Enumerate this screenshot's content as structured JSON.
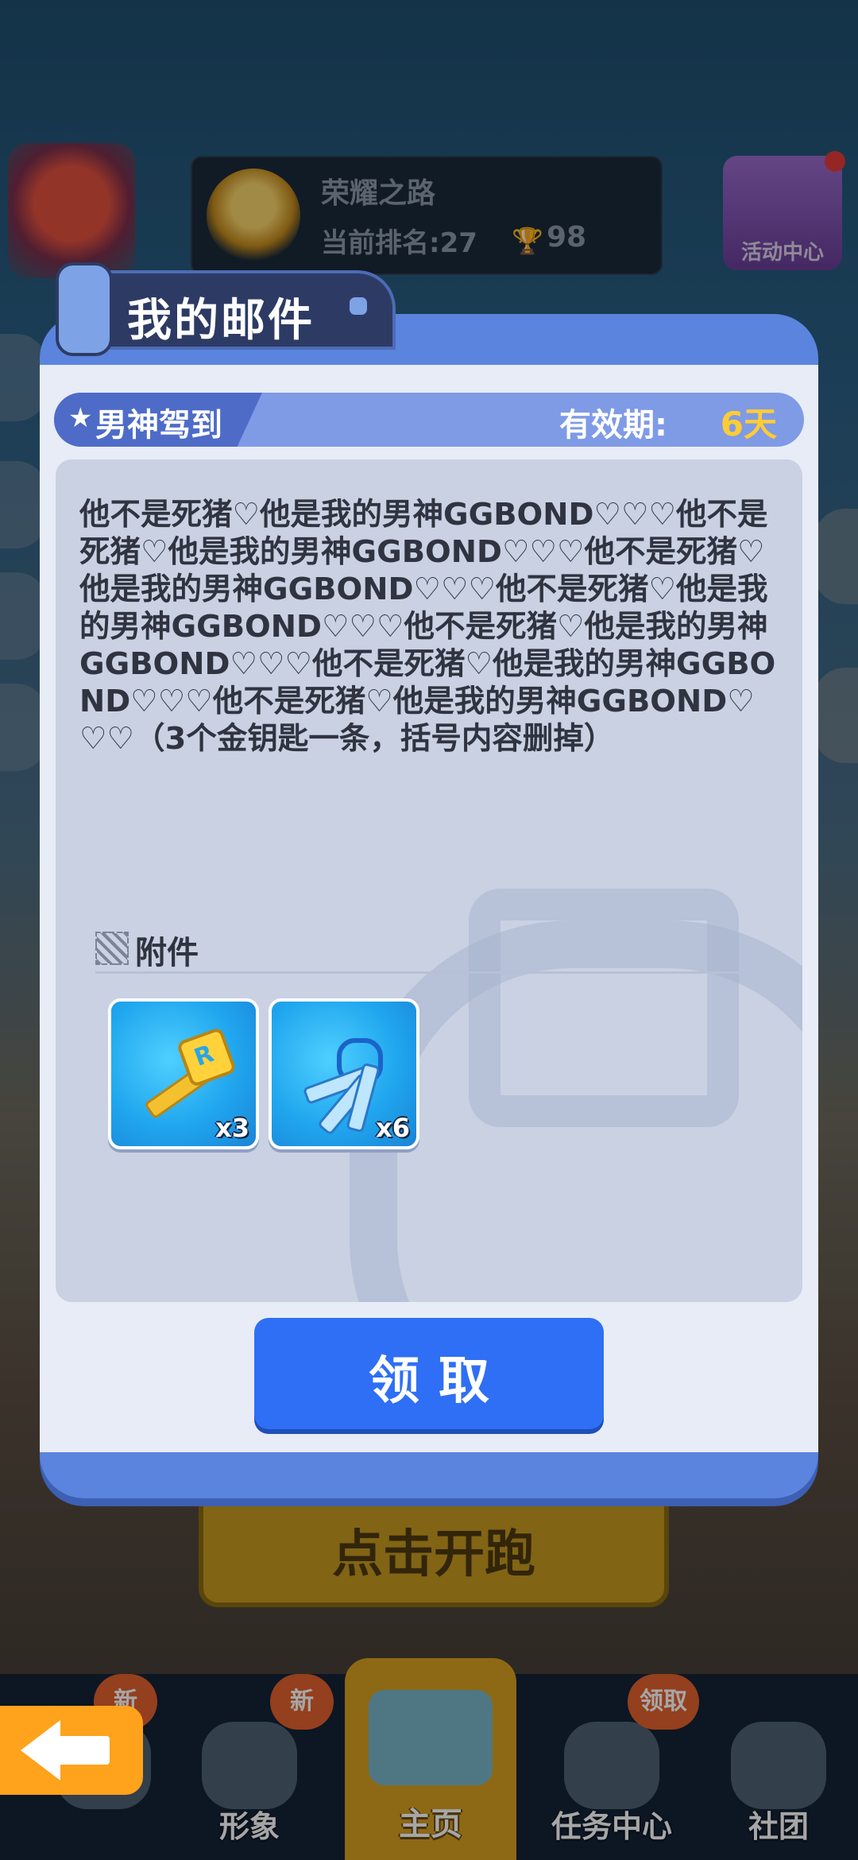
{
  "background": {
    "glory_panel": {
      "title": "荣耀之路",
      "rank_label": "当前排名:27",
      "trophy_count": "98"
    },
    "activity_center": {
      "label": "活动中心"
    },
    "start_button": {
      "label": "点击开跑"
    },
    "bottom_nav": {
      "items": [
        {
          "label": "",
          "badge": "新"
        },
        {
          "label": "形象",
          "badge": "新"
        },
        {
          "label": "主页",
          "badge": ""
        },
        {
          "label": "任务中心",
          "badge": "领取"
        },
        {
          "label": "社团",
          "badge": ""
        }
      ]
    }
  },
  "mail_modal": {
    "title": "我的邮件",
    "subject": "男神驾到",
    "validity_label": "有效期:",
    "validity_value": "6天",
    "message": "他不是死猪♡他是我的男神GGBOND♡♡♡他不是死猪♡他是我的男神GGBOND♡♡♡他不是死猪♡他是我的男神GGBOND♡♡♡他不是死猪♡他是我的男神GGBOND♡♡♡他不是死猪♡他是我的男神GGBOND♡♡♡他不是死猪♡他是我的男神GGBOND♡♡♡他不是死猪♡他是我的男神GGBOND♡♡♡（3个金钥匙一条，括号内容删掉）",
    "attachments_label": "附件",
    "attachments": [
      {
        "name": "gold-key",
        "quantity": "x3"
      },
      {
        "name": "blue-keys",
        "quantity": "x6"
      }
    ],
    "claim_button": "领取"
  },
  "colors": {
    "modal_border": "#5b84de",
    "claim_button": "#2f6ff5",
    "validity_value": "#ffcc35",
    "back_button": "#ffa21c"
  }
}
